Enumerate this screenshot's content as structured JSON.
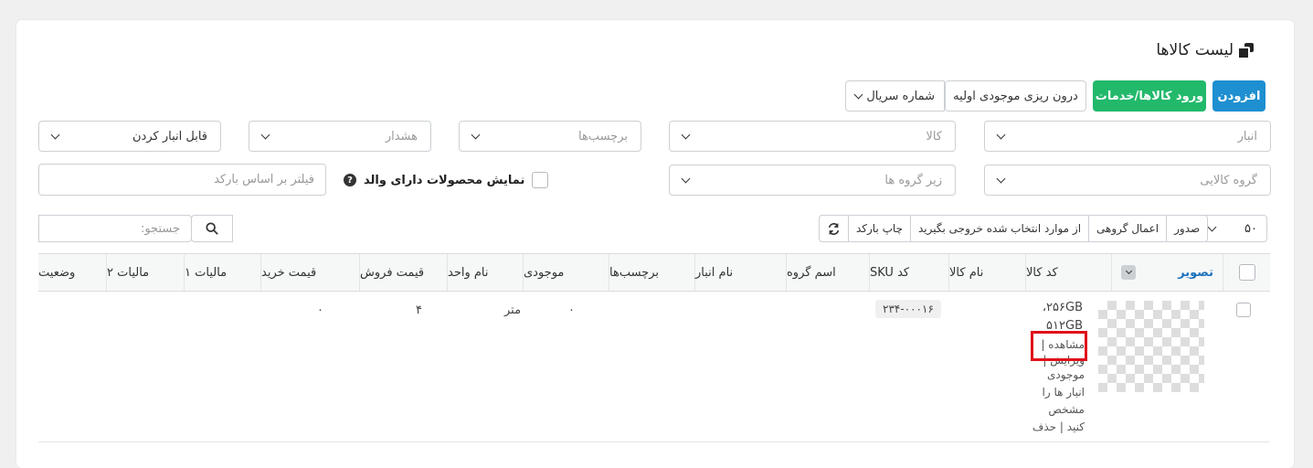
{
  "page": {
    "title": "لیست کالاها",
    "title_icon": "copy-icon"
  },
  "actions": {
    "add": "افزودن",
    "import_products": "ورود کالاها/خدمات",
    "import_initial_stock": "درون ریزی موجودی اولیه",
    "serial_select": "شماره سریال"
  },
  "filters": {
    "warehouse": "انبار",
    "product": "کالا",
    "tags": "برچسب‌ها",
    "warning": "هشدار",
    "storable": "قابل انبار کردن",
    "product_group": "گروه کالایی",
    "subgroup": "زیر گروه ها",
    "show_parent_products": "نمایش محصولات دارای والد",
    "barcode_filter_placeholder": "فیلتر بر اساس بارکد"
  },
  "toolbar": {
    "page_size": "۵۰",
    "export": "صدور",
    "bulk_apply": "اعمال گروهی",
    "export_selected": "از موارد انتخاب شده خروجی بگیرید",
    "print_barcode": "چاپ بارکد",
    "refresh_icon": "refresh-icon"
  },
  "search": {
    "placeholder": "جستجو:"
  },
  "table": {
    "columns": {
      "image": "تصویر",
      "code": "کد کالا",
      "name": "نام کالا",
      "sku": "کد SKU",
      "group": "اسم گروه",
      "warehouse": "نام انبار",
      "tags": "برچسب‌ها",
      "stock": "موجودی",
      "unit": "نام واحد",
      "sale_price": "قیمت فروش",
      "purchase_price": "قیمت خرید",
      "tax1": "مالیات ۱",
      "tax2": "مالیات ۲",
      "status": "وضعیت"
    },
    "rows": [
      {
        "code_line1": "۲۵۶GB،",
        "code_line2": "۵۱۲GB",
        "action_view": "مشاهده |",
        "action_edit": "ویرایش |",
        "action_stock1": "موجودی",
        "action_stock2": "انبار ها را",
        "action_stock3": "مشخص",
        "action_delete": "کنید | حذف",
        "sku": "۲۳۴-۰۰۰۱۶",
        "stock": "۰",
        "unit": "متر",
        "sale_price": "۴",
        "purchase_price": "۰"
      }
    ]
  },
  "colors": {
    "primary": "#1e8fd0",
    "success": "#22b96b",
    "highlight": "#e0111a"
  }
}
